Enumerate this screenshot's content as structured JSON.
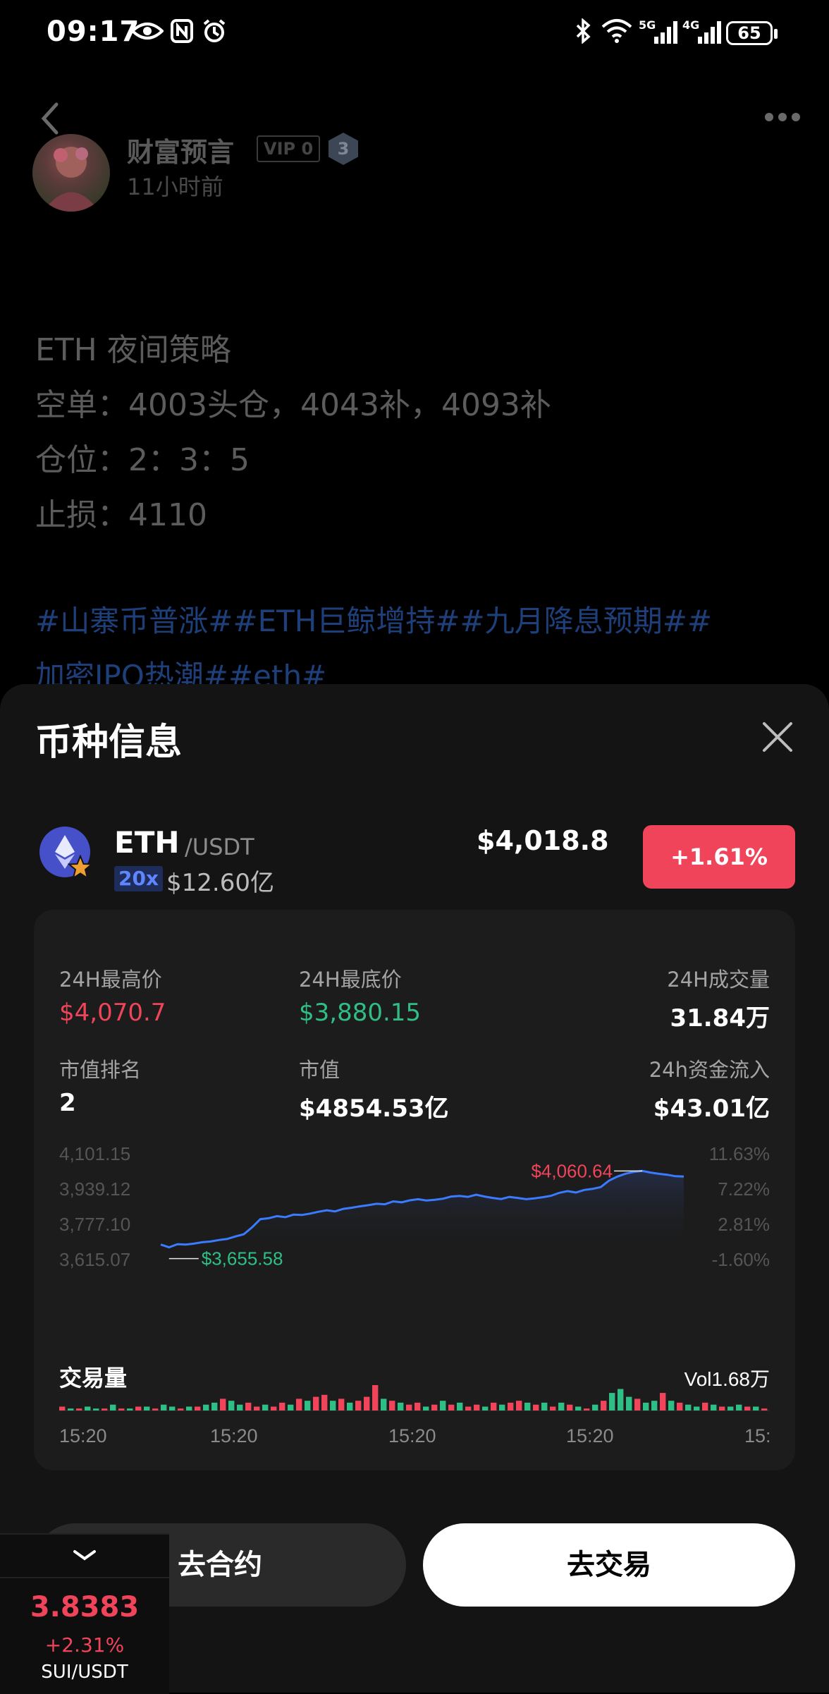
{
  "status_bar": {
    "time": "09:17",
    "network_5g": "5G",
    "network_4g": "4G",
    "battery": "65"
  },
  "post": {
    "author": "财富预言",
    "vip": "VIP 0",
    "level": "3",
    "time_ago": "11小时前",
    "lines": [
      "ETH 夜间策略",
      "空单：4003头仓，4043补，4093补",
      "仓位：2：3：5",
      "止损：4110"
    ],
    "hashtags_line1": "#山寨币普涨##ETH巨鲸增持##九月降息预期##",
    "hashtags_line2": "加密IPO热潮##eth#"
  },
  "sheet": {
    "title": "币种信息",
    "coin": {
      "symbol": "ETH",
      "quote": "/USDT",
      "leverage": "20x",
      "market_cap_short": "$12.60亿",
      "price": "$4,018.8",
      "change": "+1.61%"
    },
    "stats": {
      "high_label": "24H最高价",
      "high_value": "$4,070.7",
      "low_label": "24H最底价",
      "low_value": "$3,880.15",
      "volume_label": "24H成交量",
      "volume_value": "31.84万",
      "rank_label": "市值排名",
      "rank_value": "2",
      "mcap_label": "市值",
      "mcap_value": "$4854.53亿",
      "inflow_label": "24h资金流入",
      "inflow_value": "$43.01亿"
    },
    "volume_title": "交易量",
    "volume_total": "Vol1.68万",
    "time_labels": [
      "15:20",
      "15:20",
      "15:20",
      "15:20",
      "15:"
    ],
    "contract_button": "去合约",
    "trade_button": "去交易"
  },
  "ticker": {
    "price": "3.8383",
    "change": "+2.31%",
    "pair": "SUI/USDT"
  },
  "colors": {
    "up_red": "#f0445a",
    "down_green": "#2fbf86",
    "line_blue": "#3b7bff"
  },
  "chart_data": {
    "type": "line",
    "y_ticks_left": [
      "4,101.15",
      "3,939.12",
      "3,777.10",
      "3,615.07"
    ],
    "y_ticks_right": [
      "11.63%",
      "7.22%",
      "2.81%",
      "-1.60%"
    ],
    "ylim": [
      3615.07,
      4101.15
    ],
    "high_label": "$4,060.64",
    "low_label": "$3,655.58",
    "values": [
      3655,
      3640,
      3657,
      3655,
      3660,
      3668,
      3672,
      3680,
      3686,
      3700,
      3712,
      3750,
      3795,
      3800,
      3812,
      3806,
      3820,
      3818,
      3826,
      3836,
      3844,
      3838,
      3852,
      3858,
      3866,
      3872,
      3880,
      3877,
      3893,
      3888,
      3899,
      3905,
      3898,
      3902,
      3908,
      3920,
      3923,
      3918,
      3930,
      3920,
      3912,
      3906,
      3918,
      3912,
      3905,
      3910,
      3916,
      3924,
      3940,
      3950,
      3942,
      3956,
      3962,
      3972,
      4008,
      4030,
      4046,
      4056,
      4061,
      4052,
      4045,
      4040,
      4032,
      4030
    ],
    "volume": [
      2,
      1,
      1,
      2,
      1,
      1,
      3,
      1,
      1,
      2,
      2,
      1,
      3,
      2,
      1,
      2,
      2,
      3,
      4,
      6,
      5,
      3,
      4,
      2,
      3,
      2,
      4,
      3,
      6,
      5,
      7,
      8,
      5,
      6,
      4,
      5,
      7,
      13,
      6,
      5,
      4,
      3,
      4,
      2,
      3,
      5,
      3,
      4,
      2,
      3,
      2,
      4,
      3,
      4,
      5,
      4,
      3,
      4,
      2,
      4,
      3,
      2,
      1,
      3,
      5,
      9,
      11,
      7,
      6,
      4,
      5,
      9,
      5,
      4,
      3,
      2,
      4,
      3,
      2,
      2,
      3,
      2,
      2,
      1
    ],
    "volume_up": [
      0,
      1,
      0,
      1,
      1,
      0,
      1,
      0,
      1,
      0,
      1,
      0,
      1,
      1,
      0,
      1,
      0,
      1,
      1,
      0,
      1,
      1,
      0,
      0,
      1,
      0,
      0,
      1,
      0,
      1,
      0,
      0,
      1,
      0,
      1,
      0,
      0,
      0,
      1,
      0,
      1,
      0,
      0,
      1,
      0,
      1,
      0,
      1,
      0,
      0,
      1,
      0,
      1,
      0,
      0,
      1,
      0,
      1,
      0,
      1,
      0,
      1,
      0,
      1,
      0,
      1,
      1,
      1,
      0,
      1,
      1,
      0,
      1,
      0,
      1,
      1,
      0,
      1,
      0,
      1,
      1,
      0,
      1,
      0
    ]
  }
}
